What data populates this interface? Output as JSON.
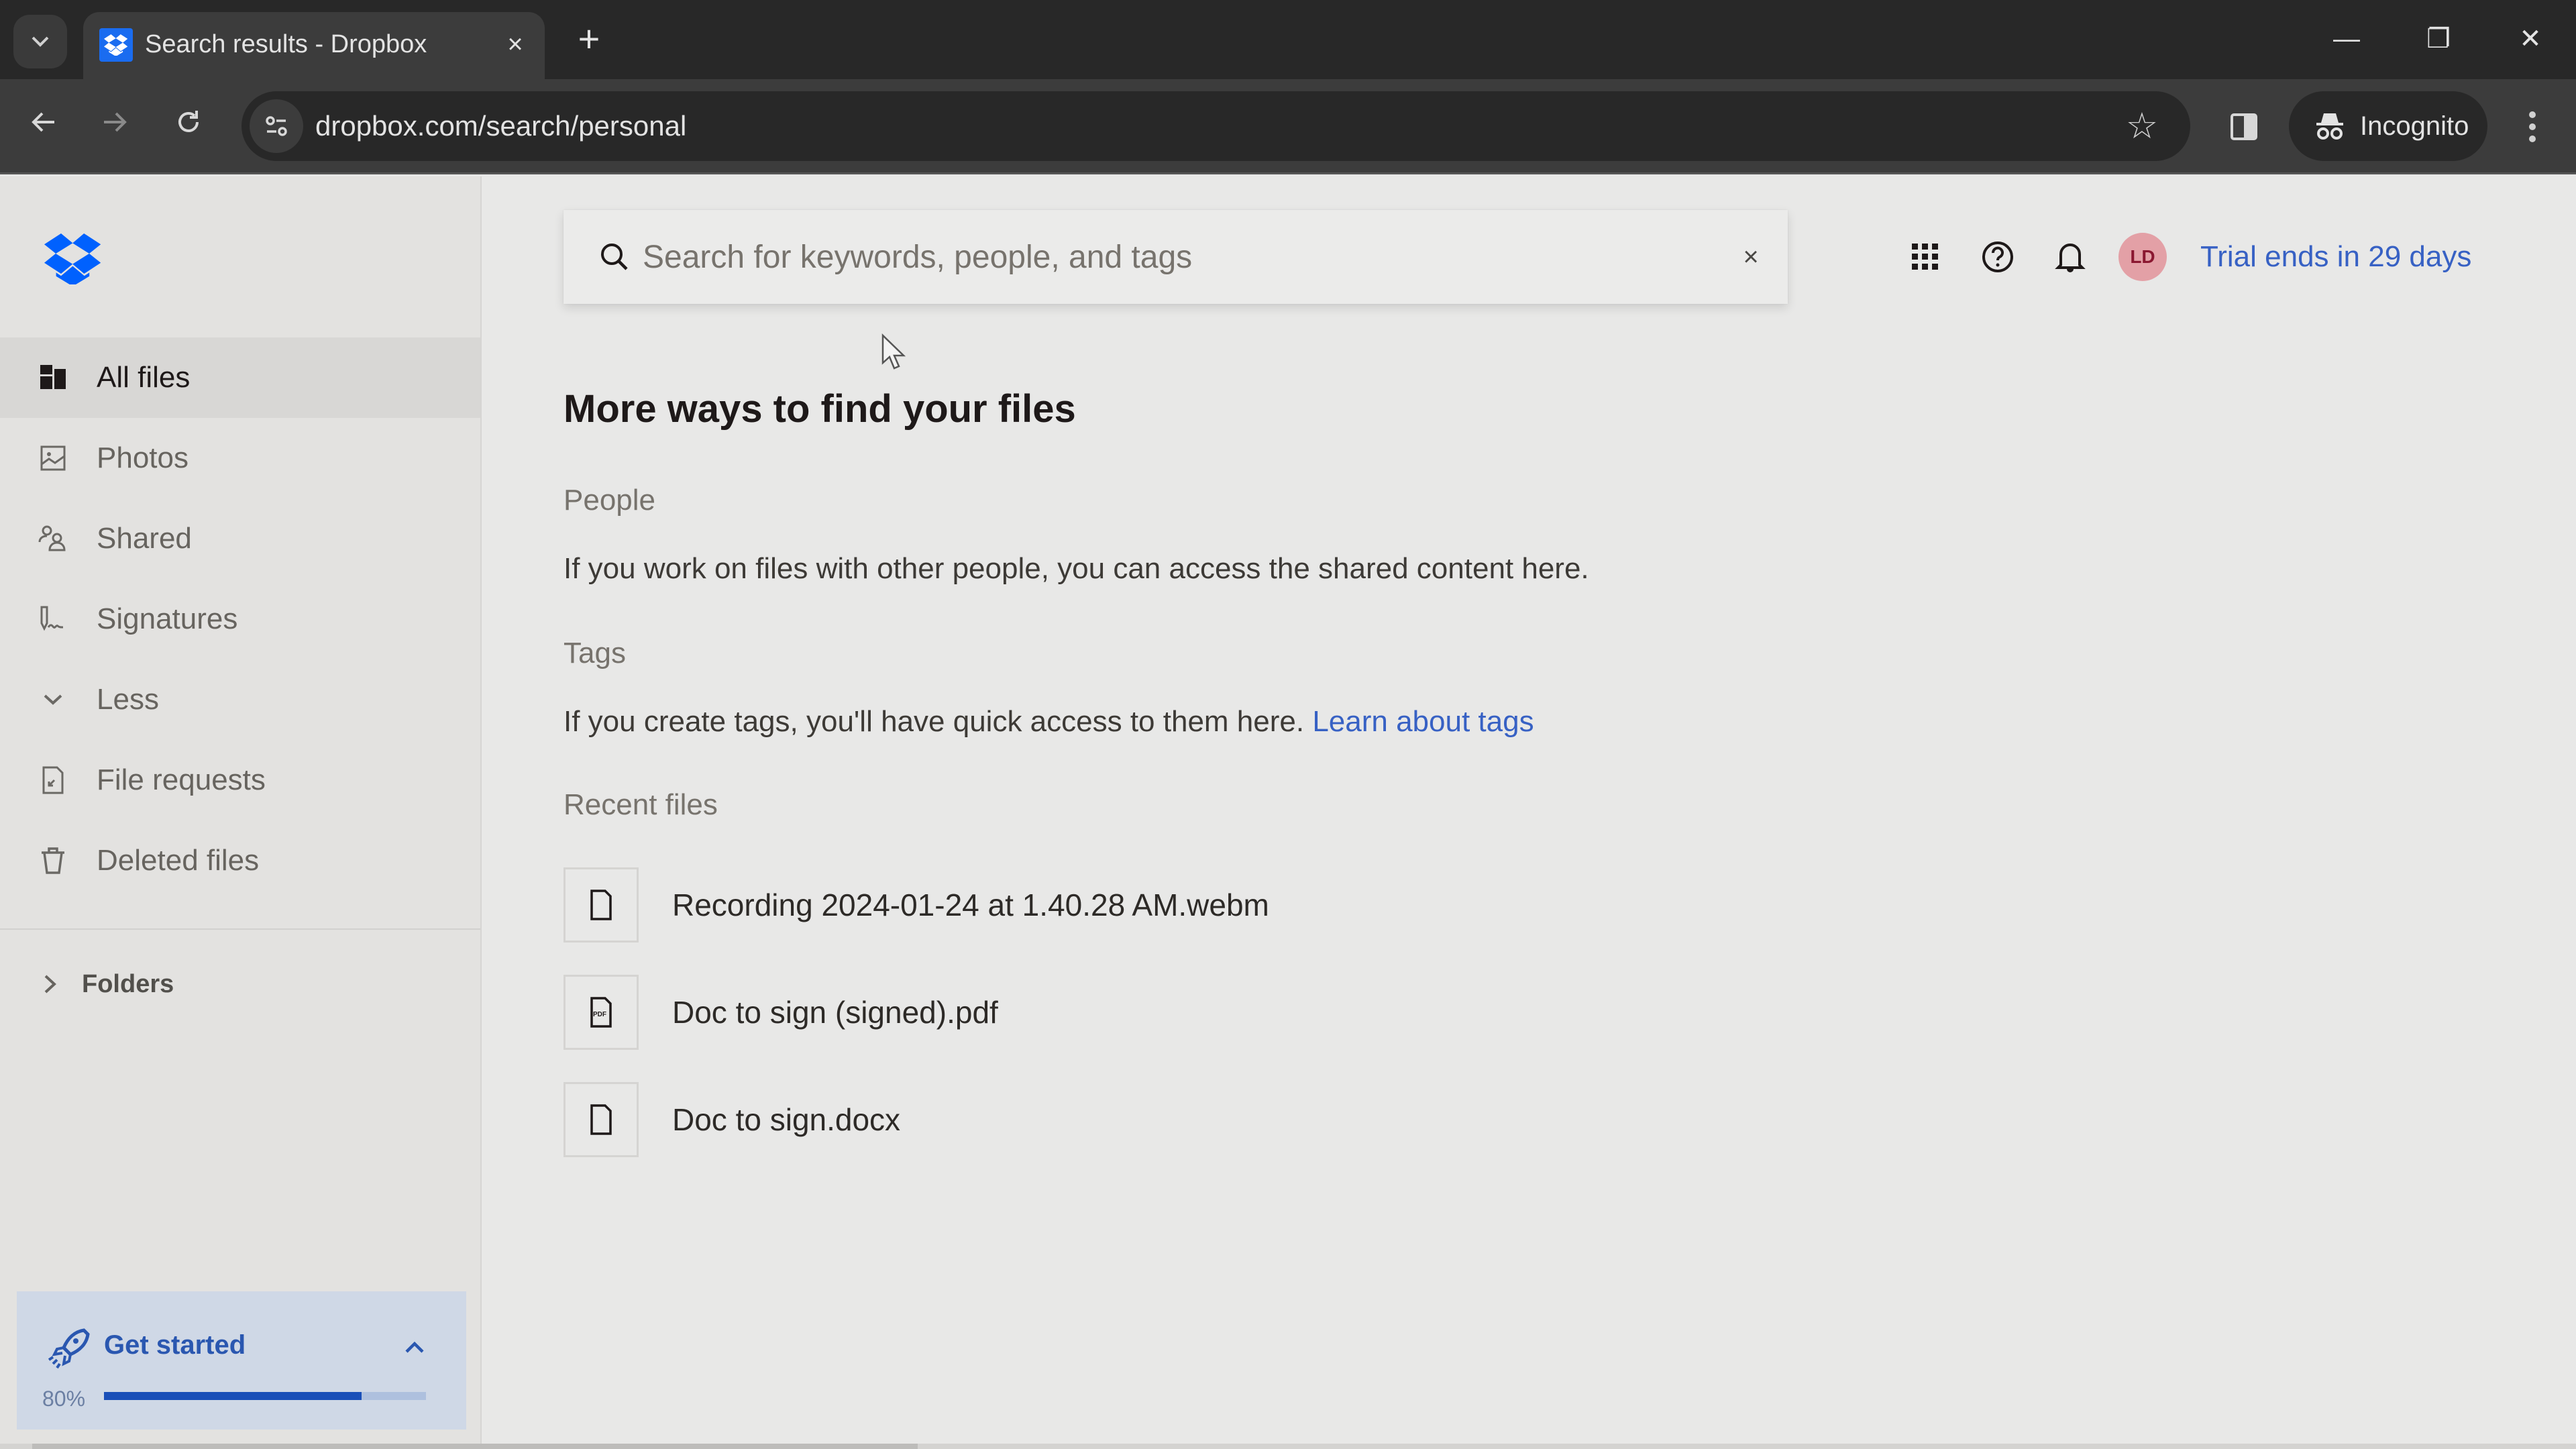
{
  "browser": {
    "tab_title": "Search results - Dropbox",
    "tab_close": "×",
    "new_tab": "+",
    "url": "dropbox.com/search/personal",
    "incognito_label": "Incognito",
    "window_controls": {
      "minimize": "—",
      "restore": "❐",
      "close": "✕"
    }
  },
  "sidebar": {
    "items": [
      {
        "label": "All files",
        "icon": "all-files-icon",
        "active": true
      },
      {
        "label": "Photos",
        "icon": "photos-icon",
        "active": false
      },
      {
        "label": "Shared",
        "icon": "shared-icon",
        "active": false
      },
      {
        "label": "Signatures",
        "icon": "signature-icon",
        "active": false
      },
      {
        "label": "Less",
        "icon": "chevron-down-icon",
        "active": false
      },
      {
        "label": "File requests",
        "icon": "file-request-icon",
        "active": false
      },
      {
        "label": "Deleted files",
        "icon": "trash-icon",
        "active": false
      }
    ],
    "folders_label": "Folders",
    "get_started": {
      "title": "Get started",
      "percent_label": "80%",
      "progress": 0.8
    }
  },
  "search": {
    "placeholder": "Search for keywords, people, and tags",
    "value": "",
    "clear": "×"
  },
  "header": {
    "avatar_initials": "LD",
    "trial_text": "Trial ends in 29 days"
  },
  "main": {
    "heading": "More ways to find your files",
    "people": {
      "label": "People",
      "text": "If you work on files with other people, you can access the shared content here."
    },
    "tags": {
      "label": "Tags",
      "text": "If you create tags, you'll have quick access to them here.",
      "link": "Learn about tags"
    },
    "recent": {
      "label": "Recent files",
      "files": [
        {
          "name": "Recording 2024-01-24 at 1.40.28 AM.webm",
          "type": "file"
        },
        {
          "name": "Doc to sign (signed).pdf",
          "type": "pdf"
        },
        {
          "name": "Doc to sign.docx",
          "type": "file"
        }
      ]
    }
  },
  "colors": {
    "accent": "#3761c4",
    "brand": "#0061fe",
    "progress_fill": "#1a4fb8",
    "avatar_bg": "#e3a0a6"
  }
}
